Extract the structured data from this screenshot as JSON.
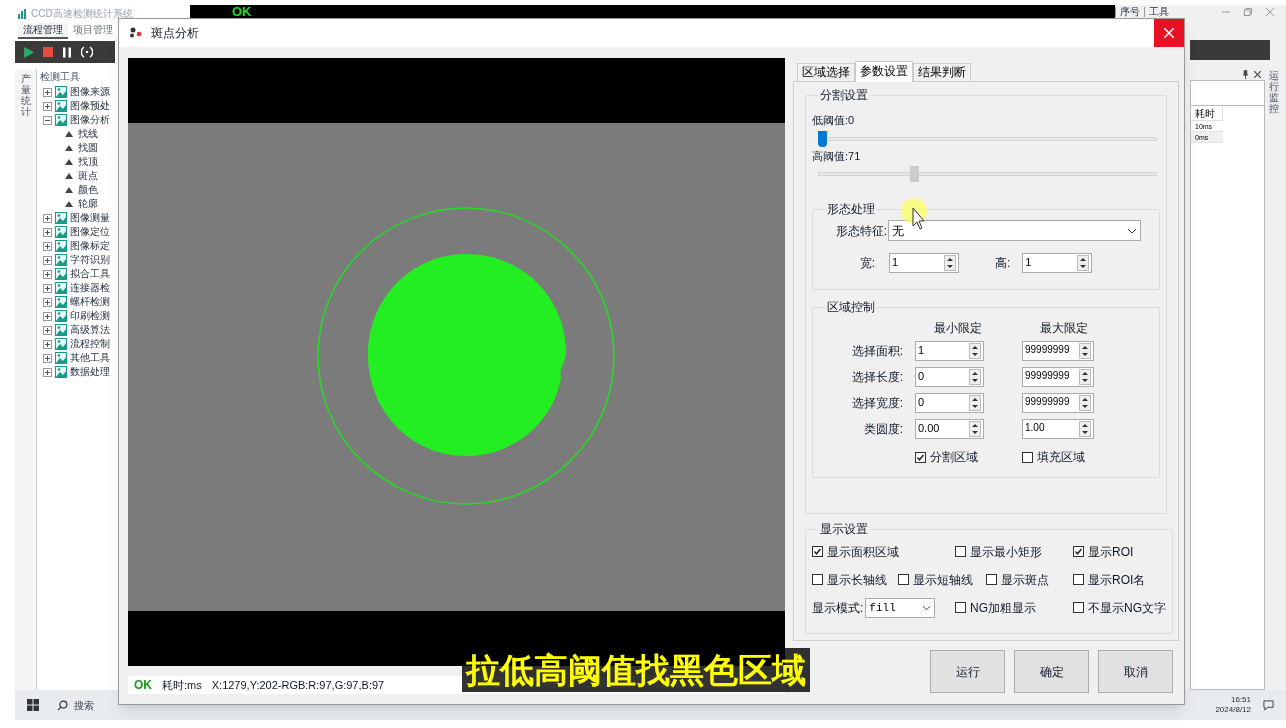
{
  "app": {
    "title": "CCD高速检测统计系统",
    "tabs": [
      {
        "label": "流程管理",
        "selected": true
      },
      {
        "label": "项目管理",
        "selected": false
      }
    ],
    "side_tab": "产量统计",
    "tool_panel": {
      "title": "检测工具",
      "tree": [
        {
          "label": "图像来源",
          "expanded": false
        },
        {
          "label": "图像预处",
          "expanded": false
        },
        {
          "label": "图像分析",
          "expanded": true,
          "children": [
            {
              "label": "找线"
            },
            {
              "label": "找圆"
            },
            {
              "label": "找顶"
            },
            {
              "label": "斑点"
            },
            {
              "label": "颜色"
            },
            {
              "label": "轮廓"
            }
          ]
        },
        {
          "label": "图像测量",
          "expanded": false
        },
        {
          "label": "图像定位",
          "expanded": false
        },
        {
          "label": "图像标定",
          "expanded": false
        },
        {
          "label": "字符识别",
          "expanded": false
        },
        {
          "label": "拟合工具",
          "expanded": false
        },
        {
          "label": "连接器检",
          "expanded": false
        },
        {
          "label": "螺杆检测",
          "expanded": false
        },
        {
          "label": "印刷检测",
          "expanded": false
        },
        {
          "label": "高级算法",
          "expanded": false
        },
        {
          "label": "流程控制",
          "expanded": false
        },
        {
          "label": "其他工具",
          "expanded": false
        },
        {
          "label": "数据处理",
          "expanded": false
        }
      ]
    },
    "result_banner": "OK",
    "grid_columns": [
      "序号",
      "工具"
    ],
    "monitor": {
      "side_tab": "运行监控",
      "column": "耗时",
      "rows": [
        "10ms",
        "0ms"
      ]
    }
  },
  "dialog": {
    "title": "斑点分析",
    "status": {
      "result": "OK",
      "time": "耗时:ms",
      "pixel": "X:1279,Y:202-RGB:R:97,G:97,B:97"
    },
    "tabs": [
      {
        "label": "区域选择",
        "selected": false
      },
      {
        "label": "参数设置",
        "selected": true
      },
      {
        "label": "结果判断",
        "selected": false
      }
    ],
    "segmentation": {
      "title": "分割设置",
      "sliders": [
        {
          "label": "低阈值:0",
          "level": 0,
          "pressed": false
        },
        {
          "label": "高阈值:71",
          "level": 0.28,
          "pressed": true
        }
      ]
    },
    "morphology": {
      "title": "形态处理",
      "feature_label": "形态特征:",
      "feature_value": "无",
      "width_label": "宽:",
      "width_value": "1",
      "height_label": "高:",
      "height_value": "1"
    },
    "region_control": {
      "title": "区域控制",
      "min_header": "最小限定",
      "max_header": "最大限定",
      "rows": [
        {
          "label": "选择面积:",
          "min": "1",
          "max": "99999999"
        },
        {
          "label": "选择长度:",
          "min": "0",
          "max": "99999999"
        },
        {
          "label": "选择宽度:",
          "min": "0",
          "max": "99999999"
        },
        {
          "label": "类圆度:",
          "min": "0.00",
          "max": "1.00"
        }
      ],
      "checkboxes": [
        {
          "label": "分割区域",
          "checked": true
        },
        {
          "label": "填充区域",
          "checked": false
        }
      ]
    },
    "display": {
      "title": "显示设置",
      "checkboxes": [
        {
          "label": "显示面积区域",
          "checked": true
        },
        {
          "label": "显示最小矩形",
          "checked": false
        },
        {
          "label": "显示ROI",
          "checked": true
        },
        {
          "label": "显示长轴线",
          "checked": false
        },
        {
          "label": "显示短轴线",
          "checked": false
        },
        {
          "label": "显示斑点",
          "checked": false
        },
        {
          "label": "显示ROI名",
          "checked": false
        },
        {
          "label": "NG加粗显示",
          "checked": false
        },
        {
          "label": "不显示NG文字",
          "checked": false
        }
      ],
      "mode_label": "显示模式:",
      "mode_value": "fill"
    },
    "buttons": [
      "运行",
      "确定",
      "取消"
    ]
  },
  "caption": "拉低高阈值找黑色区域",
  "taskbar": {
    "search": "搜索",
    "time": "16:51",
    "date": "2024/8/12"
  }
}
